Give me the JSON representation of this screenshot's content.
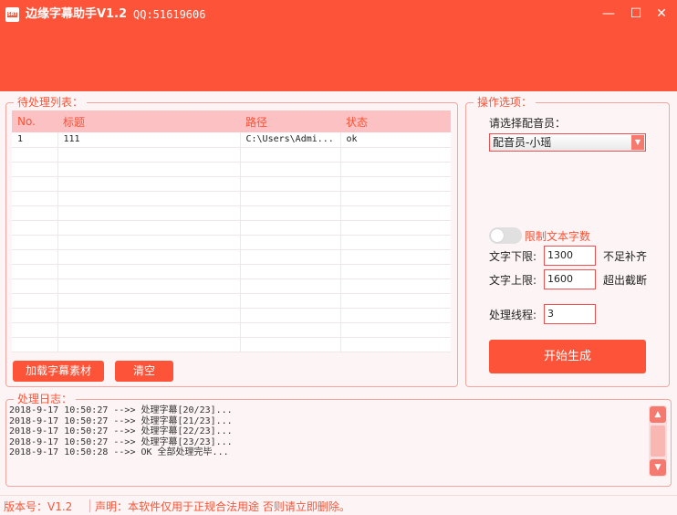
{
  "window": {
    "title": "边缘字幕助手V1.2",
    "qq": "QQ:51619606",
    "icon_text": "SRT",
    "minimize": "—",
    "maximize": "☐",
    "close": "✕"
  },
  "list_panel": {
    "legend": "待处理列表：",
    "columns": [
      "No.",
      "标题",
      "路径",
      "状态"
    ],
    "rows": [
      [
        "1",
        "111",
        "C:\\Users\\Admi...",
        "ok"
      ]
    ],
    "add_button": "加载字幕素材",
    "clear_button": "清空"
  },
  "options_panel": {
    "legend": "操作选项：",
    "voice_label": "请选择配音员：",
    "voice_selected": "配音员-小瑶",
    "limit_label": "限制文本字数",
    "min_label": "文字下限:",
    "min_value": "1300",
    "min_note": "不足补齐",
    "max_label": "文字上限:",
    "max_value": "1600",
    "max_note": "超出截断",
    "threads_label": "处理线程:",
    "threads_value": "3",
    "start_button": "开始生成"
  },
  "log_panel": {
    "legend": "处理日志：",
    "lines": [
      "2018-9-17 10:50:27 -->> 处理字幕[20/23]...",
      "2018-9-17 10:50:27 -->> 处理字幕[21/23]...",
      "2018-9-17 10:50:27 -->> 处理字幕[22/23]...",
      "2018-9-17 10:50:27 -->> 处理字幕[23/23]...",
      "2018-9-17 10:50:28 -->> OK 全部处理完毕..."
    ]
  },
  "statusbar": {
    "version": "版本号：V1.2",
    "notice": "声明：本软件仅用于正规合法用途 否则请立即删除。"
  },
  "colors": {
    "accent": "#fd5338",
    "header_row": "#fcc1c3",
    "border": "#f4a5a0"
  }
}
